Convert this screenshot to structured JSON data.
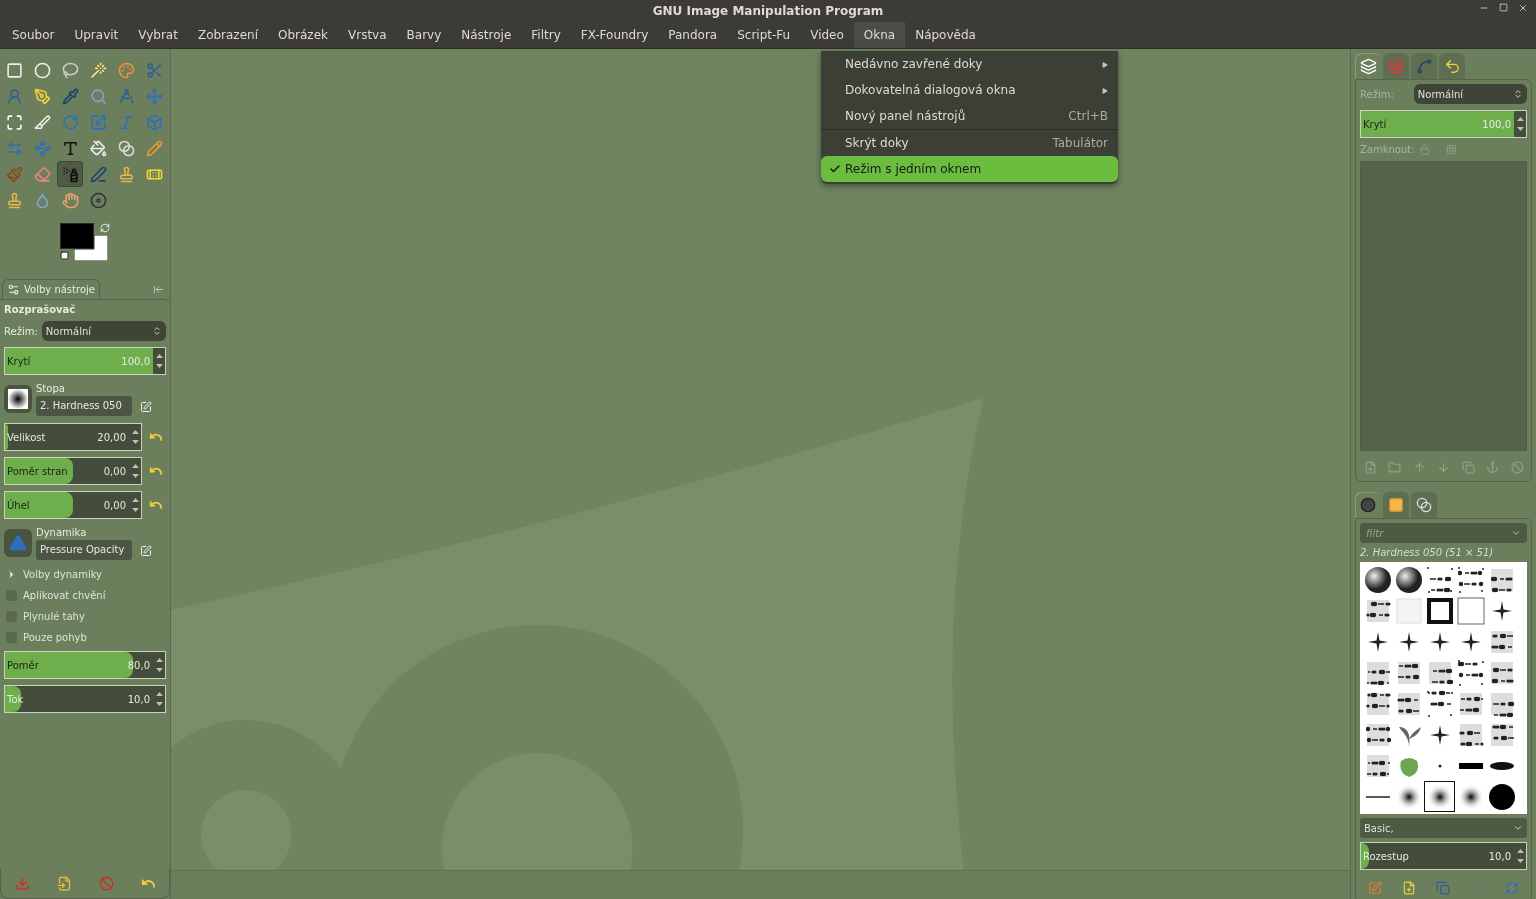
{
  "window": {
    "title": "GNU Image Manipulation Program"
  },
  "menubar": [
    {
      "label": "Soubor",
      "selected": false
    },
    {
      "label": "Upravit",
      "selected": false
    },
    {
      "label": "Vybrat",
      "selected": false
    },
    {
      "label": "Zobrazení",
      "selected": false
    },
    {
      "label": "Obrázek",
      "selected": false
    },
    {
      "label": "Vrstva",
      "selected": false
    },
    {
      "label": "Barvy",
      "selected": false
    },
    {
      "label": "Nástroje",
      "selected": false
    },
    {
      "label": "Filtry",
      "selected": false
    },
    {
      "label": "FX-Foundry",
      "selected": false
    },
    {
      "label": "Pandora",
      "selected": false
    },
    {
      "label": "Script-Fu",
      "selected": false
    },
    {
      "label": "Video",
      "selected": false
    },
    {
      "label": "Okna",
      "selected": true
    },
    {
      "label": "Nápověda",
      "selected": false
    }
  ],
  "window_menu": [
    {
      "kind": "submenu",
      "label": "Nedávno zavřené doky",
      "selected": false
    },
    {
      "kind": "submenu",
      "label": "Dokovatelná dialogová okna",
      "selected": false
    },
    {
      "kind": "shortcut",
      "label": "Nový panel nástrojů",
      "shortcut": "Ctrl+B",
      "selected": false
    },
    {
      "kind": "separator"
    },
    {
      "kind": "shortcut",
      "label": "Skrýt doky",
      "shortcut": "Tabulátor",
      "selected": false
    },
    {
      "kind": "check",
      "label": "Režim s jedním oknem",
      "checked": true,
      "selected": true
    }
  ],
  "toolbox": {
    "tools": [
      {
        "selected": false
      },
      {
        "selected": false
      },
      {
        "selected": false
      },
      {
        "selected": false
      },
      {
        "selected": false
      },
      {
        "selected": false
      },
      {
        "selected": false
      },
      {
        "selected": false
      },
      {
        "selected": false
      },
      {
        "selected": false
      },
      {
        "selected": false
      },
      {
        "selected": false
      },
      {
        "selected": false
      },
      {
        "selected": false
      },
      {
        "selected": false
      },
      {
        "selected": false
      },
      {
        "selected": false
      },
      {
        "selected": false
      },
      {
        "selected": false
      },
      {
        "selected": false
      },
      {
        "selected": false
      },
      {
        "selected": false
      },
      {
        "selected": false
      },
      {
        "selected": false
      },
      {
        "selected": false
      },
      {
        "selected": false
      },
      {
        "selected": true
      },
      {
        "selected": false
      },
      {
        "selected": false
      },
      {
        "selected": false
      },
      {
        "selected": false
      },
      {
        "selected": false
      },
      {
        "selected": false
      },
      {
        "selected": false
      }
    ],
    "swatches": [
      {
        "color": "#000000"
      },
      {
        "color": "#ffffff"
      }
    ]
  },
  "tool_options": {
    "tab": "Volby nástroje",
    "tool": "Rozprašovač",
    "mode_label": "Režim:",
    "mode": "Normální",
    "controls": [
      {
        "kind": "slider",
        "label": "Krytí",
        "value": "100,0",
        "level": 1,
        "reset": false
      },
      {
        "kind": "brush",
        "label": "Stopa",
        "value": "2. Hardness 050"
      },
      {
        "kind": "slider",
        "label": "Velikost",
        "value": "20,00",
        "level": 0.02,
        "reset": true
      },
      {
        "kind": "slider",
        "label": "Poměr stran",
        "value": "0,00",
        "level": 0.5,
        "reset": true
      },
      {
        "kind": "slider",
        "label": "Úhel",
        "value": "0,00",
        "level": 0.5,
        "reset": true
      },
      {
        "kind": "dynamics",
        "label": "Dynamika",
        "value": "Pressure Opacity"
      },
      {
        "kind": "expander",
        "label": "Volby dynamiky",
        "expanded": false
      },
      {
        "kind": "check",
        "label": "Aplikovat chvění",
        "checked": false
      },
      {
        "kind": "check",
        "label": "Plynulé tahy",
        "checked": false
      },
      {
        "kind": "check",
        "label": "Pouze pohyb",
        "checked": false
      },
      {
        "kind": "slider",
        "label": "Poměr",
        "value": "80,0",
        "level": 0.8,
        "reset": false
      },
      {
        "kind": "slider",
        "label": "Tok",
        "value": "10,0",
        "level": 0.1,
        "reset": false
      }
    ]
  },
  "layers": {
    "tabs": [
      {
        "selected": true
      },
      {
        "selected": false
      },
      {
        "selected": false
      },
      {
        "selected": false
      }
    ],
    "mode_label": "Režim:",
    "mode": "Normální",
    "opacity": {
      "label": "Krytí",
      "value": "100,0",
      "level": 1
    },
    "lock_label": "Zamknout:",
    "buttons": [
      {
        "disabled": true
      },
      {
        "disabled": true
      },
      {
        "disabled": true
      },
      {
        "disabled": true
      },
      {
        "disabled": true
      },
      {
        "disabled": true
      },
      {
        "disabled": true
      }
    ]
  },
  "brushes": {
    "tabs": [
      {
        "selected": true
      },
      {
        "selected": false
      },
      {
        "selected": false
      }
    ],
    "filter_placeholder": "filtr",
    "current": "2. Hardness 050 (51 × 51)",
    "items": [
      {
        "selected": false
      },
      {
        "selected": false
      },
      {
        "selected": false
      },
      {
        "selected": false
      },
      {
        "selected": false
      },
      {
        "selected": false
      },
      {
        "selected": false
      },
      {
        "selected": false
      },
      {
        "selected": false
      },
      {
        "selected": false
      },
      {
        "selected": false
      },
      {
        "selected": false
      },
      {
        "selected": false
      },
      {
        "selected": false
      },
      {
        "selected": false
      },
      {
        "selected": false
      },
      {
        "selected": false
      },
      {
        "selected": false
      },
      {
        "selected": false
      },
      {
        "selected": false
      },
      {
        "selected": false
      },
      {
        "selected": false
      },
      {
        "selected": false
      },
      {
        "selected": false
      },
      {
        "selected": false
      },
      {
        "selected": false
      },
      {
        "selected": false
      },
      {
        "selected": false
      },
      {
        "selected": false
      },
      {
        "selected": false
      },
      {
        "selected": false
      },
      {
        "selected": false
      },
      {
        "selected": false
      },
      {
        "selected": false
      },
      {
        "selected": false
      },
      {
        "selected": false
      },
      {
        "selected": false
      },
      {
        "selected": true
      },
      {
        "selected": false
      },
      {
        "selected": false
      }
    ],
    "tag": "Basic,",
    "spacing": {
      "label": "Rozestup",
      "value": "10,0",
      "level": 0.05
    },
    "buttons": [
      {
        "disabled": false
      },
      {
        "disabled": false
      },
      {
        "disabled": false
      },
      {
        "disabled": true
      },
      {
        "disabled": false
      }
    ]
  }
}
